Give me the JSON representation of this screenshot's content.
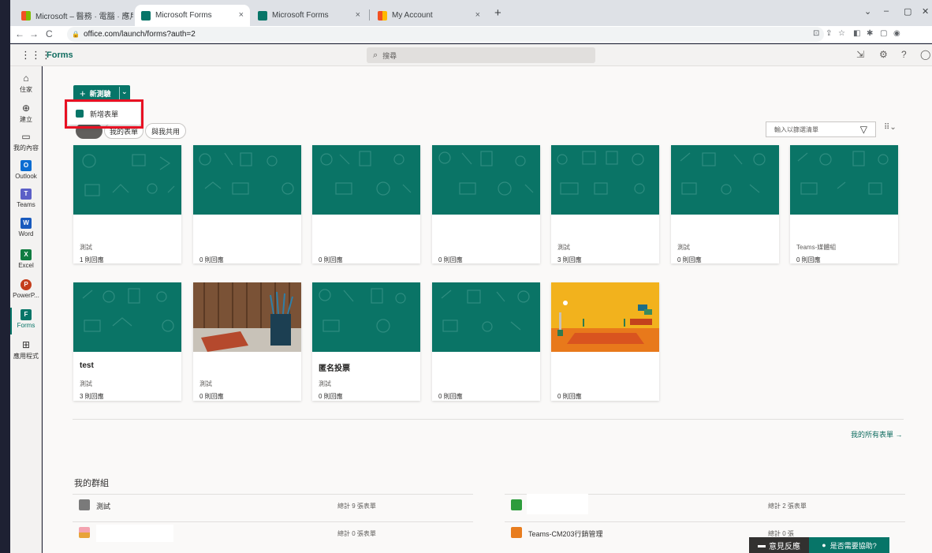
{
  "browser": {
    "tabs": [
      {
        "label": "Microsoft – 醫務 · 電腦 · 應用程 ×",
        "active": false
      },
      {
        "label": "Microsoft Forms",
        "active": true
      },
      {
        "label": "Microsoft Forms",
        "active": false
      },
      {
        "label": "My Account",
        "active": false
      }
    ],
    "tab_close": "×",
    "new_tab": "+",
    "url": "office.com/launch/forms?auth=2",
    "window_controls": [
      "⌄",
      "–",
      "▢",
      "✕"
    ]
  },
  "app": {
    "title": "Forms",
    "search_placeholder": "搜尋"
  },
  "rail": [
    {
      "label": "住家",
      "icon": "home-icon"
    },
    {
      "label": "建立",
      "icon": "create-icon"
    },
    {
      "label": "我的內容",
      "icon": "folder-icon"
    },
    {
      "label": "Outlook",
      "icon": "outlook-icon"
    },
    {
      "label": "Teams",
      "icon": "teams-icon"
    },
    {
      "label": "Word",
      "icon": "word-icon"
    },
    {
      "label": "Excel",
      "icon": "excel-icon"
    },
    {
      "label": "PowerP...",
      "icon": "powerpoint-icon"
    },
    {
      "label": "Forms",
      "icon": "forms-icon"
    },
    {
      "label": "應用程式",
      "icon": "apps-icon"
    }
  ],
  "toolbar": {
    "new_quiz": "新測驗",
    "dropdown_item": "新增表單",
    "pill_partial": "我的表單",
    "pill_shared": "與我共用",
    "filter_placeholder": "輸入以篩選清單"
  },
  "cards_row1": [
    {
      "title": "",
      "owner": "測試",
      "responses": "1 則回應"
    },
    {
      "title": "",
      "owner": "",
      "responses": "0 則回應"
    },
    {
      "title": "",
      "owner": "",
      "responses": "0 則回應"
    },
    {
      "title": "",
      "owner": "",
      "responses": "0 則回應"
    },
    {
      "title": "",
      "owner": "測試",
      "responses": "3 則回應"
    },
    {
      "title": "",
      "owner": "測試",
      "responses": "0 則回應"
    },
    {
      "title": "",
      "owner": "Teams-媒體組",
      "responses": "0 則回應"
    }
  ],
  "cards_row2": [
    {
      "title": "test",
      "owner": "測試",
      "responses": "3 則回應"
    },
    {
      "title": "",
      "owner": "測試",
      "responses": "0 則回應"
    },
    {
      "title": "匿名投票",
      "owner": "測試",
      "responses": "0 則回應"
    },
    {
      "title": "",
      "owner": "",
      "responses": "0 則回應"
    },
    {
      "title": "",
      "owner": "",
      "responses": "0 則回應"
    }
  ],
  "all_forms_link": "我的所有表單 →",
  "groups": {
    "title": "我的群組",
    "rows": [
      {
        "name": "測試",
        "count": "總計 9 張表單"
      },
      {
        "name": "",
        "count": "總計 0 張表單"
      },
      {
        "name": "",
        "count": "總計 2 張表單"
      },
      {
        "name": "Teams-CM203行銷管理",
        "count": "總計 0 張"
      }
    ]
  },
  "footer": {
    "feedback": "意見反應",
    "help": "是否需要協助?"
  },
  "colors": {
    "accent": "#077568",
    "highlight": "#e81123"
  }
}
